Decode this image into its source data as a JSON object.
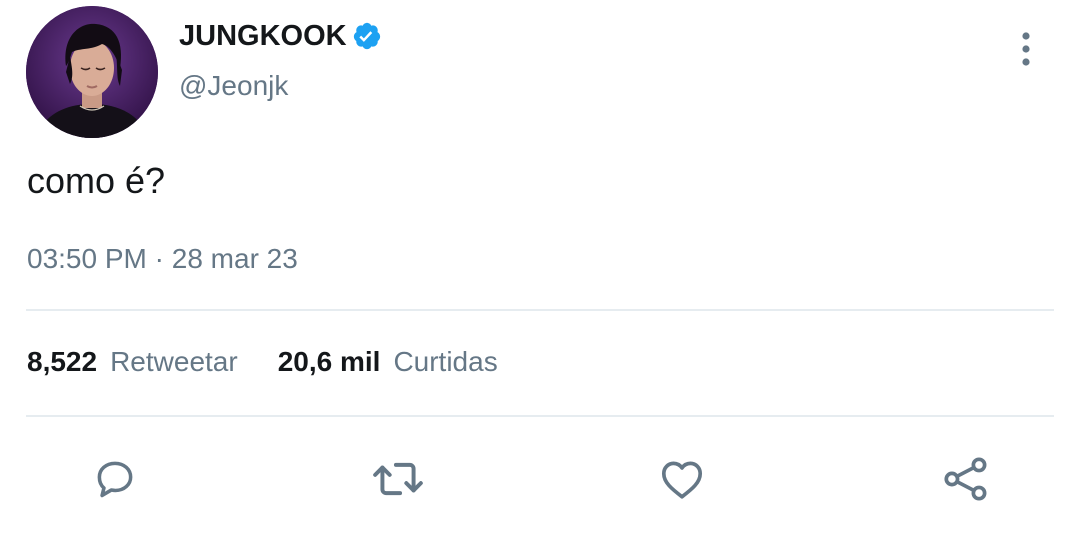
{
  "tweet": {
    "author": {
      "display_name": "JUNGKOOK",
      "handle": "@Jeonjk",
      "verified": true,
      "verified_color": "#1da1f2",
      "avatar_icon": "profile-photo"
    },
    "text": "como é?",
    "time": "03:50 PM",
    "separator": "·",
    "date": "28 mar 23",
    "stats": {
      "retweets_count": "8,522",
      "retweets_label": "Retweetar",
      "likes_count": "20,6 mil",
      "likes_label": "Curtidas"
    },
    "actions": {
      "reply_icon": "reply-icon",
      "retweet_icon": "retweet-icon",
      "like_icon": "heart-icon",
      "share_icon": "share-icon"
    },
    "menu_icon": "more-options-icon"
  },
  "colors": {
    "text_primary": "#14171a",
    "text_secondary": "#657786",
    "divider": "#e6ecf0",
    "icon": "#657786"
  }
}
